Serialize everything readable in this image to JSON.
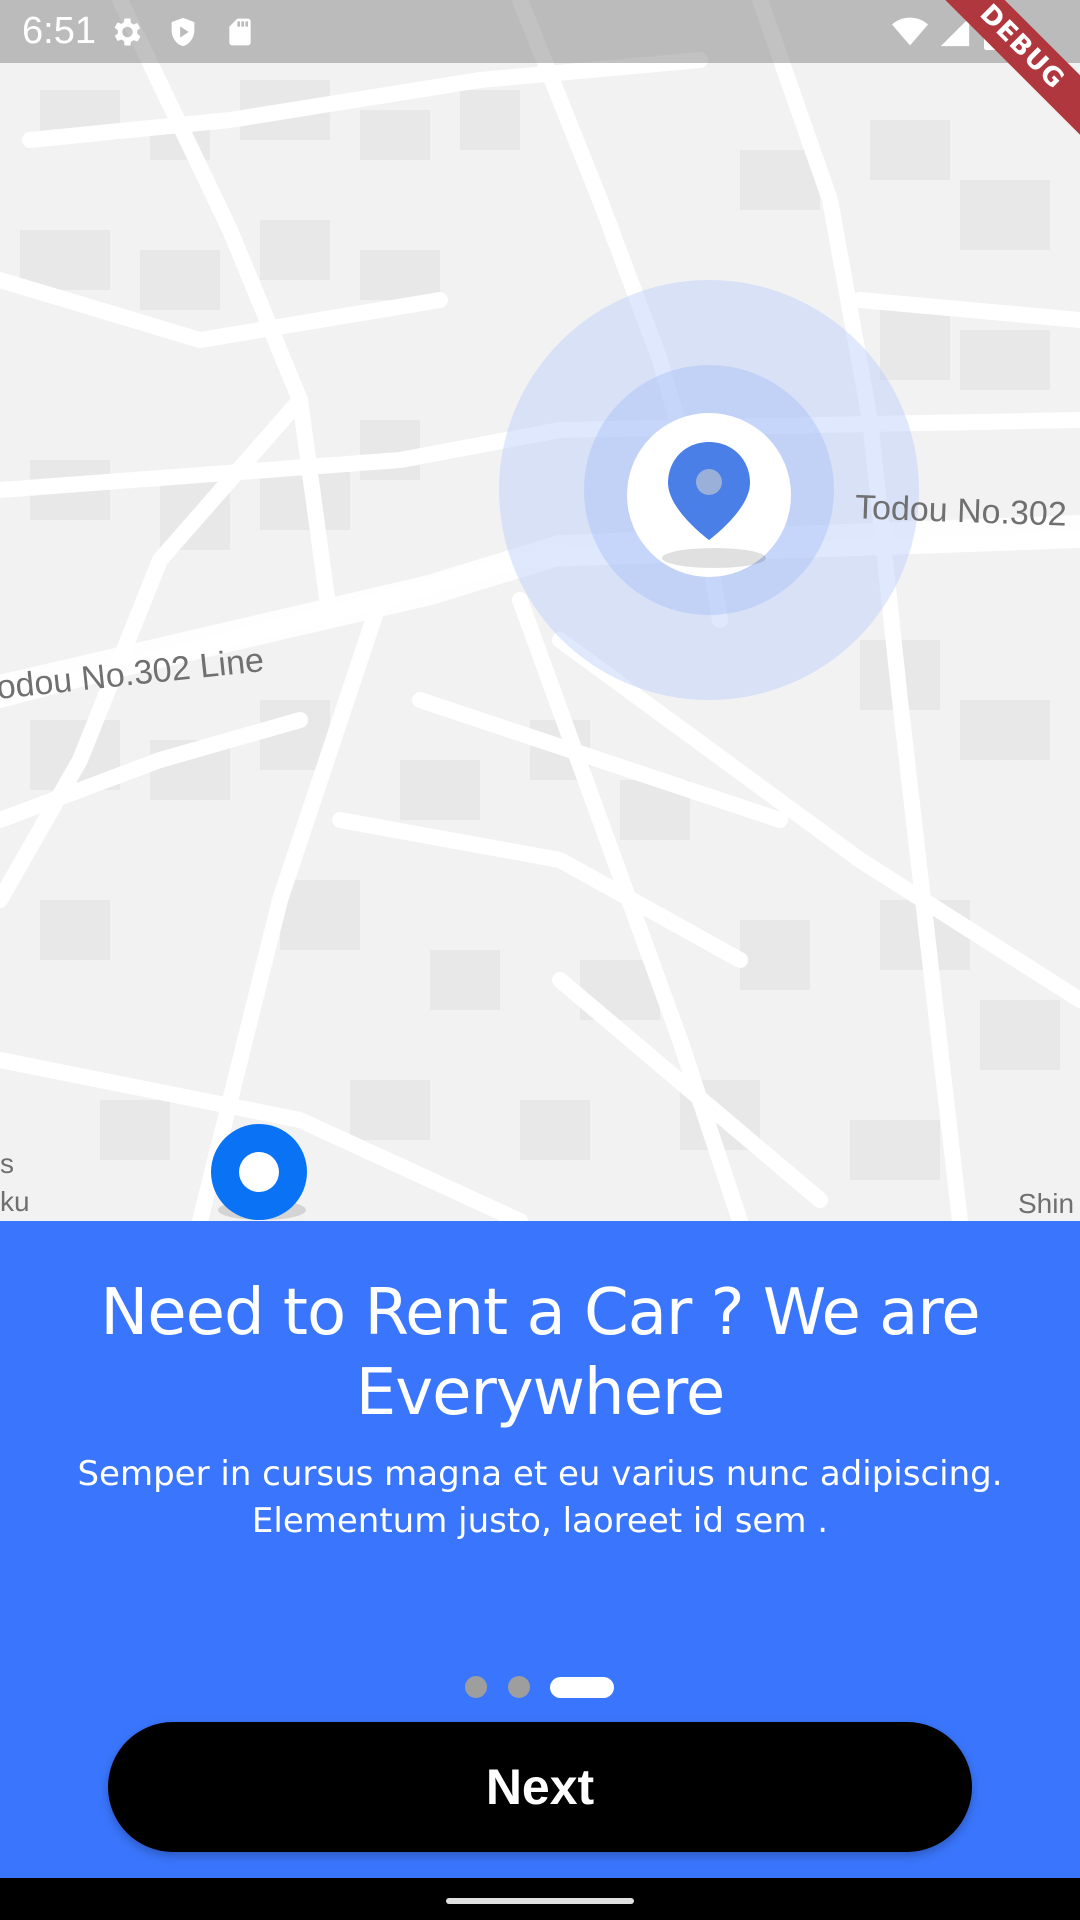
{
  "status_bar": {
    "time": "6:51",
    "debug_label": "DEBUG",
    "icons": [
      "settings-icon",
      "shield-icon",
      "sd-card-icon",
      "wifi-icon",
      "signal-icon",
      "battery-icon"
    ]
  },
  "map": {
    "labels": {
      "road_right": "Todou No.302",
      "road_left": "odou No.302 Line",
      "corner_left_top": "s",
      "corner_left_bottom": "ku",
      "corner_right_bottom": "Shin"
    },
    "colors": {
      "background": "#f2f2f2",
      "road": "#ffffff",
      "building": "#e8e8e8",
      "accuracy_circle": "#c9d9fb",
      "pin": "#4a7fe8",
      "origin_marker": "#0a73f5"
    }
  },
  "onboarding": {
    "title": "Need to Rent a Car ? We are Everywhere",
    "subtitle": "Semper in cursus magna et eu varius nunc adipiscing. Elementum justo, laoreet id sem .",
    "page_indicator": {
      "total": 3,
      "active": 3
    },
    "next_label": "Next",
    "colors": {
      "panel": "#3a76fd",
      "button": "#000000",
      "dot_inactive": "#9e9e9e",
      "dot_active": "#ffffff"
    }
  }
}
